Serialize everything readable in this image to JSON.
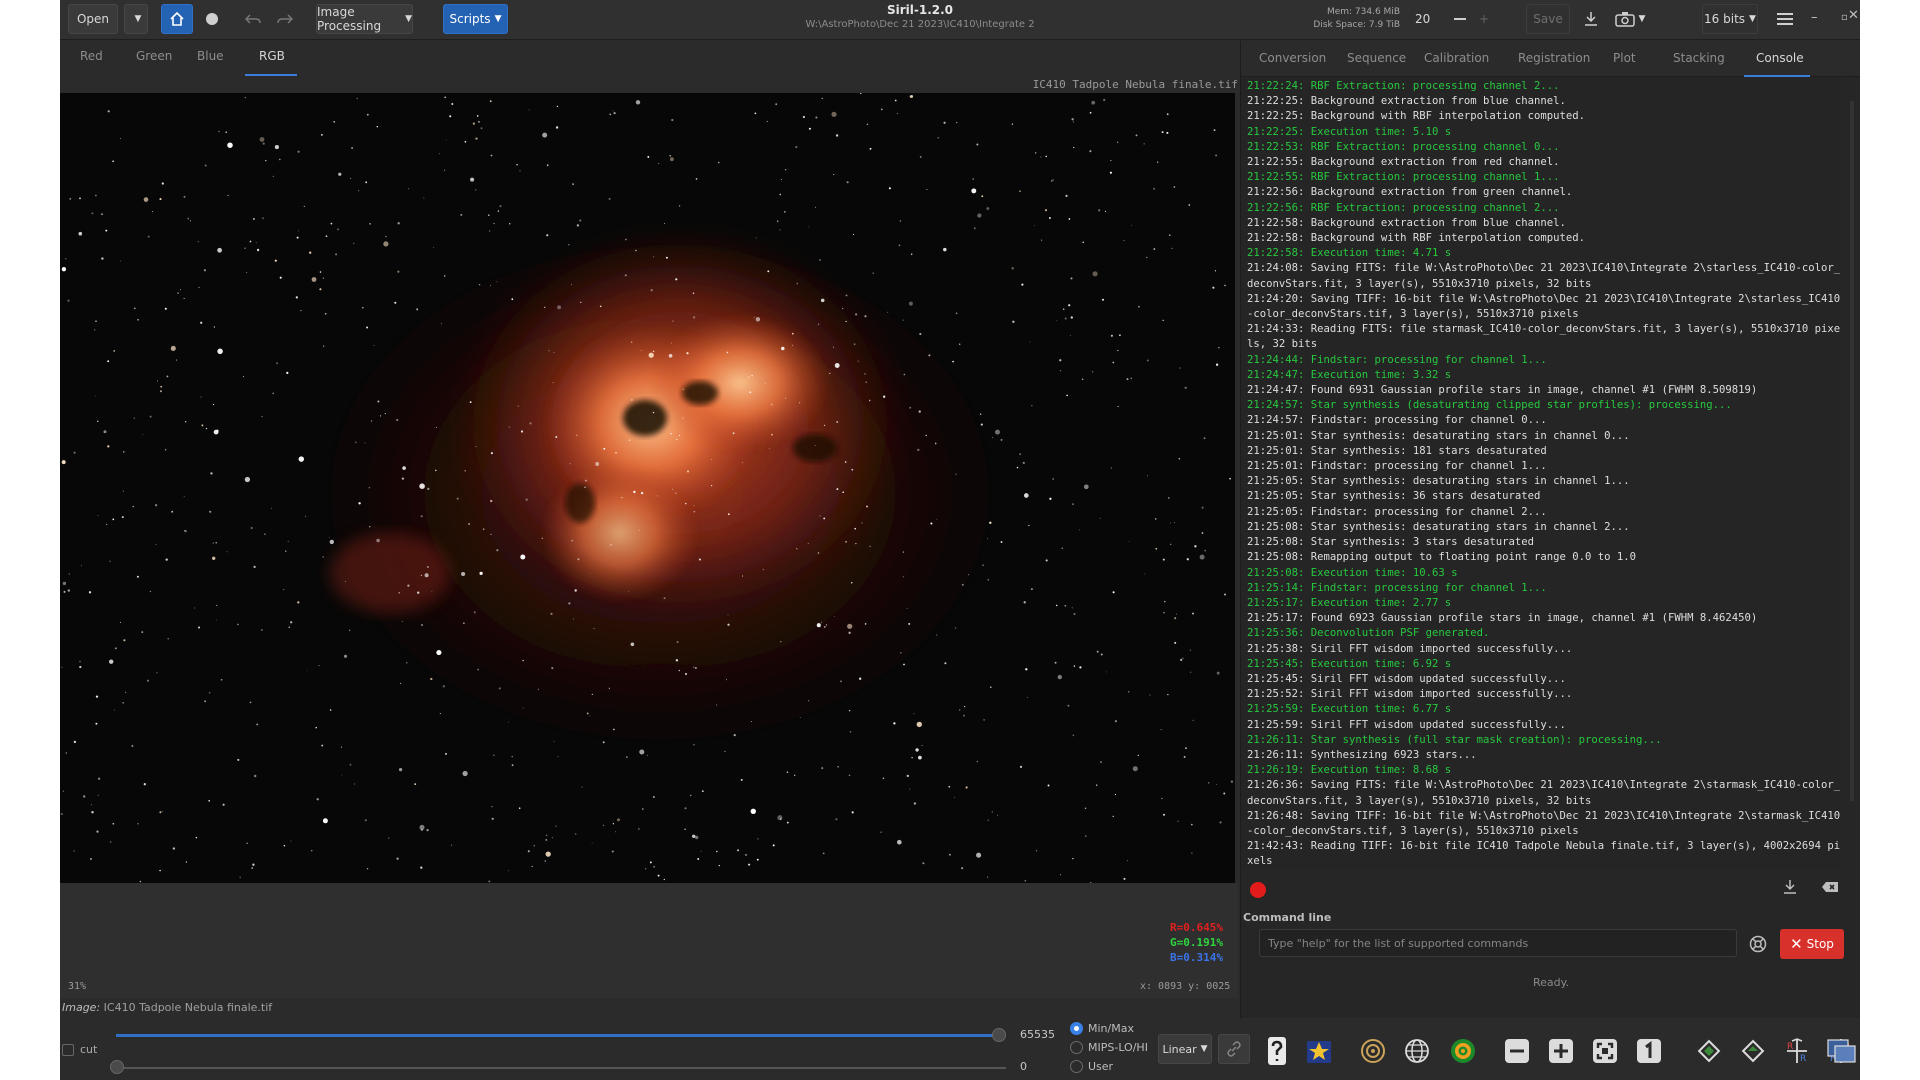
{
  "header": {
    "open_label": "Open",
    "image_processing_label": "Image Processing",
    "scripts_label": "Scripts",
    "app_title": "Siril-1.2.0",
    "cwd": "W:\\AstroPhoto\\Dec 21 2023\\IC410\\Integrate 2",
    "mem": "Mem: 734.6 MiB",
    "disk": "Disk Space: 7.9 TiB",
    "threads_value": "20",
    "save_label": "Save",
    "bits_label": "16 bits"
  },
  "channel_tabs": [
    "Red",
    "Green",
    "Blue",
    "RGB"
  ],
  "active_channel": "RGB",
  "image": {
    "name_label": "IC410 Tadpole Nebula finale.tif",
    "r_value": "R=0.645%",
    "g_value": "G=0.191%",
    "b_value": "B=0.314%",
    "zoom": "31%",
    "coords": "x: 0893 y: 0025",
    "info_prefix": "Image:",
    "info_name": "IC410 Tadpole Nebula finale.tif"
  },
  "panel_tabs": [
    "Conversion",
    "Sequence",
    "Calibration",
    "Registration",
    "Plot",
    "Stacking",
    "Console"
  ],
  "active_panel_tab": "Console",
  "console_lines": [
    {
      "t": "21:22:24: RBF Extraction: processing channel 2...",
      "g": true
    },
    {
      "t": "21:22:25: Background extraction from blue channel.",
      "g": false
    },
    {
      "t": "21:22:25: Background with RBF interpolation computed.",
      "g": false
    },
    {
      "t": "21:22:25: Execution time: 5.10 s",
      "g": true
    },
    {
      "t": "21:22:53: RBF Extraction: processing channel 0...",
      "g": true
    },
    {
      "t": "21:22:55: Background extraction from red channel.",
      "g": false
    },
    {
      "t": "21:22:55: RBF Extraction: processing channel 1...",
      "g": true
    },
    {
      "t": "21:22:56: Background extraction from green channel.",
      "g": false
    },
    {
      "t": "21:22:56: RBF Extraction: processing channel 2...",
      "g": true
    },
    {
      "t": "21:22:58: Background extraction from blue channel.",
      "g": false
    },
    {
      "t": "21:22:58: Background with RBF interpolation computed.",
      "g": false
    },
    {
      "t": "21:22:58: Execution time: 4.71 s",
      "g": true
    },
    {
      "t": "21:24:08: Saving FITS: file W:\\AstroPhoto\\Dec 21 2023\\IC410\\Integrate 2\\starless_IC410-color_deconvStars.fit, 3 layer(s), 5510x3710 pixels, 32 bits",
      "g": false
    },
    {
      "t": "21:24:20: Saving TIFF: 16-bit file W:\\AstroPhoto\\Dec 21 2023\\IC410\\Integrate 2\\starless_IC410-color_deconvStars.tif, 3 layer(s), 5510x3710 pixels",
      "g": false
    },
    {
      "t": "21:24:33: Reading FITS: file starmask_IC410-color_deconvStars.fit, 3 layer(s), 5510x3710 pixels, 32 bits",
      "g": false
    },
    {
      "t": "21:24:44: Findstar: processing for channel 1...",
      "g": true
    },
    {
      "t": "21:24:47: Execution time: 3.32 s",
      "g": true
    },
    {
      "t": "21:24:47: Found 6931 Gaussian profile stars in image, channel #1 (FWHM 8.509819)",
      "g": false
    },
    {
      "t": "21:24:57: Star synthesis (desaturating clipped star profiles): processing...",
      "g": true
    },
    {
      "t": "21:24:57: Findstar: processing for channel 0...",
      "g": false
    },
    {
      "t": "21:25:01: Star synthesis: desaturating stars in channel 0...",
      "g": false
    },
    {
      "t": "21:25:01: Star synthesis: 181 stars desaturated",
      "g": false
    },
    {
      "t": "21:25:01: Findstar: processing for channel 1...",
      "g": false
    },
    {
      "t": "21:25:05: Star synthesis: desaturating stars in channel 1...",
      "g": false
    },
    {
      "t": "21:25:05: Star synthesis: 36 stars desaturated",
      "g": false
    },
    {
      "t": "21:25:05: Findstar: processing for channel 2...",
      "g": false
    },
    {
      "t": "21:25:08: Star synthesis: desaturating stars in channel 2...",
      "g": false
    },
    {
      "t": "21:25:08: Star synthesis: 3 stars desaturated",
      "g": false
    },
    {
      "t": "21:25:08: Remapping output to floating point range 0.0 to 1.0",
      "g": false
    },
    {
      "t": "21:25:08: Execution time: 10.63 s",
      "g": true
    },
    {
      "t": "21:25:14: Findstar: processing for channel 1...",
      "g": true
    },
    {
      "t": "21:25:17: Execution time: 2.77 s",
      "g": true
    },
    {
      "t": "21:25:17: Found 6923 Gaussian profile stars in image, channel #1 (FWHM 8.462450)",
      "g": false
    },
    {
      "t": "21:25:36: Deconvolution PSF generated.",
      "g": true
    },
    {
      "t": "21:25:38: Siril FFT wisdom imported successfully...",
      "g": false
    },
    {
      "t": "21:25:45: Execution time: 6.92 s",
      "g": true
    },
    {
      "t": "21:25:45: Siril FFT wisdom updated successfully...",
      "g": false
    },
    {
      "t": "21:25:52: Siril FFT wisdom imported successfully...",
      "g": false
    },
    {
      "t": "21:25:59: Execution time: 6.77 s",
      "g": true
    },
    {
      "t": "21:25:59: Siril FFT wisdom updated successfully...",
      "g": false
    },
    {
      "t": "21:26:11: Star synthesis (full star mask creation): processing...",
      "g": true
    },
    {
      "t": "21:26:11: Synthesizing 6923 stars...",
      "g": false
    },
    {
      "t": "21:26:19: Execution time: 8.68 s",
      "g": true
    },
    {
      "t": "21:26:36: Saving FITS: file W:\\AstroPhoto\\Dec 21 2023\\IC410\\Integrate 2\\starmask_IC410-color_deconvStars.fit, 3 layer(s), 5510x3710 pixels, 32 bits",
      "g": false
    },
    {
      "t": "21:26:48: Saving TIFF: 16-bit file W:\\AstroPhoto\\Dec 21 2023\\IC410\\Integrate 2\\starmask_IC410-color_deconvStars.tif, 3 layer(s), 5510x3710 pixels",
      "g": false
    },
    {
      "t": "21:42:43: Reading TIFF: 16-bit file IC410 Tadpole Nebula finale.tif, 3 layer(s), 4002x2694 pixels",
      "g": false
    }
  ],
  "command": {
    "label": "Command line",
    "placeholder": "Type \"help\" for the list of supported commands",
    "stop_label": "Stop",
    "status": "Ready."
  },
  "bottom": {
    "cut_label": "cut",
    "high_value": "65535",
    "low_value": "0",
    "radio_options": [
      "Min/Max",
      "MIPS-LO/HI",
      "User"
    ],
    "selected_radio": "Min/Max",
    "stretch_label": "Linear"
  },
  "colors": {
    "accent": "#2462b3",
    "console_green": "#27c93f",
    "stop_red": "#d8302b",
    "record_red": "#e21b1b"
  }
}
